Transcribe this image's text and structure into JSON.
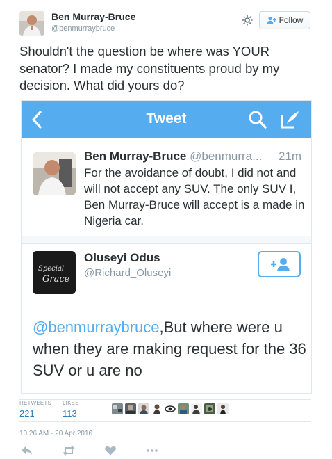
{
  "author": {
    "name": "Ben Murray-Bruce",
    "handle": "@benmurraybruce"
  },
  "follow_label": "Follow",
  "tweet_text": "Shouldn't the question be where was YOUR senator? I made my constituents proud by my decision. What did yours do?",
  "embedded": {
    "bar_title": "Tweet",
    "quoted": {
      "name": "Ben Murray-Bruce",
      "handle": "@benmurra...",
      "time": "21m",
      "text": "For the avoidance of doubt, I did not and will not accept any SUV. The only SUV I, Ben Murray-Bruce will accept is a made in Nigeria car."
    },
    "reply": {
      "name": "Oluseyi Odus",
      "handle": "@Richard_Oluseyi",
      "avatar_text_line1": "Special",
      "avatar_text_line2": "Grace",
      "mention": "@benmurraybruce",
      "text": ",But where were u when they are making request for the 36 SUV or u are no"
    }
  },
  "stats": {
    "retweets_label": "RETWEETS",
    "retweets": "221",
    "likes_label": "LIKES",
    "likes": "113"
  },
  "timestamp": "10:26 AM - 20 Apr 2016",
  "actions": [
    "reply-icon",
    "retweet-icon",
    "like-icon",
    "more-icon"
  ],
  "colors": {
    "accent": "#55acee",
    "link": "#2b7bb9",
    "muted": "#8899a6"
  }
}
